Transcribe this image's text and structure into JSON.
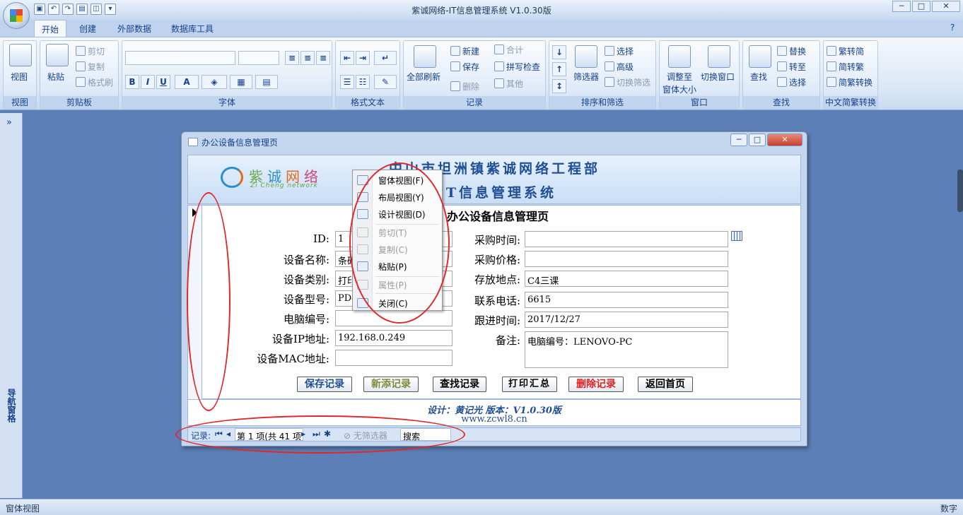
{
  "window": {
    "title": "紫诚网络-IT信息管理系统 V1.0.30版"
  },
  "tabs": [
    {
      "label": "开始",
      "active": true
    },
    {
      "label": "创建",
      "active": false
    },
    {
      "label": "外部数据",
      "active": false
    },
    {
      "label": "数据库工具",
      "active": false
    }
  ],
  "ribbon": {
    "groups": {
      "view": "视图",
      "clipboard": "剪贴板",
      "font": "字体",
      "richtext": "格式文本",
      "records": "记录",
      "sortfilter": "排序和筛选",
      "window": "窗口",
      "find": "查找",
      "chinese": "中文简繁转换"
    },
    "view_btn": "视图",
    "paste_btn": "粘贴",
    "cut": "剪切",
    "copy": "复制",
    "format_painter": "格式刷",
    "refresh_all": "全部刷新",
    "new": "新建",
    "save": "保存",
    "delete": "删除",
    "totals": "合计",
    "spelling": "拼写检查",
    "more": "其他",
    "filter": "筛选器",
    "selection": "选择",
    "advanced": "高级",
    "toggle_filter": "切换筛选",
    "fit_form": "调整至",
    "fit_form2": "窗体大小",
    "switch_window": "切换窗口",
    "find_btn": "查找",
    "replace": "替换",
    "goto": "转至",
    "select": "选择",
    "trad_to_simp": "繁转简",
    "simp_to_trad": "简转繁",
    "conv": "简繁转换",
    "bold": "B",
    "italic": "I",
    "underline": "U",
    "font_color": "A"
  },
  "navpane": {
    "label": "导航窗格",
    "chevron": "»"
  },
  "form": {
    "window_title": "办公设备信息管理页",
    "company": "中山市坦洲镇紫诚网络工程部",
    "system": "IT信息管理系统",
    "logo_text": "紫诚网络",
    "logo_sub": "Zi Cheng network",
    "page_title": "办公设备信息管理页",
    "labels": {
      "id": "ID:",
      "name": "设备名称:",
      "category": "设备类别:",
      "model": "设备型号:",
      "pc_no": "电脑编号:",
      "ip": "设备IP地址:",
      "mac": "设备MAC地址:",
      "purchase_time": "采购时间:",
      "purchase_price": "采购价格:",
      "location": "存放地点:",
      "phone": "联系电话:",
      "follow_time": "跟进时间:",
      "remark": "备注:"
    },
    "values": {
      "id": "1",
      "name": "条码",
      "category": "打印",
      "model": "PD4",
      "pc_no": "",
      "ip": "192.168.0.249",
      "mac": "",
      "purchase_time": "",
      "purchase_price": "",
      "location": "C4三课",
      "phone": "6615",
      "follow_time": "2017/12/27",
      "remark": "电脑编号：LENOVO-PC"
    },
    "buttons": {
      "save": "保存记录",
      "new": "新添记录",
      "find": "查找记录",
      "print": "打印汇总",
      "delete": "删除记录",
      "home": "返回首页"
    },
    "footer_line1": "设计：黄记光 版本：V1.0.30版",
    "footer_line2": "www.zcwl8.cn",
    "recnav": {
      "label": "记录:",
      "position": "第 1 项(共 41 项",
      "no_filter": "无筛选器",
      "search": "搜索"
    }
  },
  "context_menu": [
    {
      "label": "窗体视图(F)",
      "enabled": true
    },
    {
      "label": "布局视图(Y)",
      "enabled": true
    },
    {
      "label": "设计视图(D)",
      "enabled": true
    },
    {
      "label": "剪切(T)",
      "enabled": false
    },
    {
      "label": "复制(C)",
      "enabled": false
    },
    {
      "label": "粘贴(P)",
      "enabled": true
    },
    {
      "label": "属性(P)",
      "enabled": false
    },
    {
      "label": "关闭(C)",
      "enabled": true
    }
  ],
  "status": {
    "left": "窗体视图",
    "right": "数字"
  },
  "colors": {
    "delete_btn": "#e02020",
    "new_btn": "#7d8a3a",
    "save_btn": "#1f4e93",
    "annotation": "#e0282a"
  }
}
